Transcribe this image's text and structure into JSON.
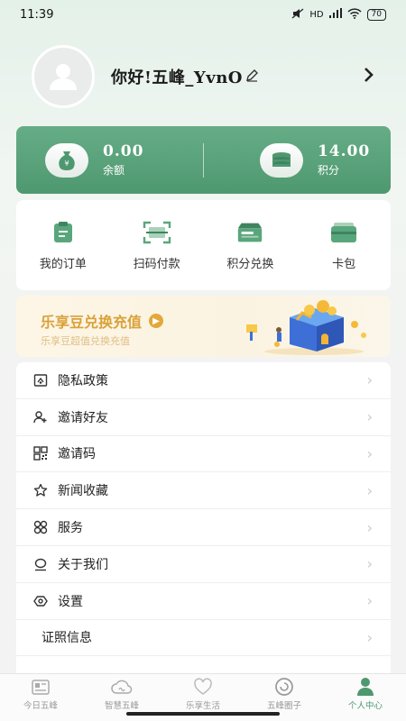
{
  "status_bar": {
    "time": "11:39",
    "battery": "70",
    "network": "HD"
  },
  "profile": {
    "greeting": "你好!五峰_YvnO"
  },
  "wallet": {
    "balance_value": "0.00",
    "balance_label": "余额",
    "points_value": "14.00",
    "points_label": "积分"
  },
  "quick_actions": [
    {
      "label": "我的订单",
      "icon": "order-icon"
    },
    {
      "label": "扫码付款",
      "icon": "scan-icon"
    },
    {
      "label": "积分兑换",
      "icon": "exchange-icon"
    },
    {
      "label": "卡包",
      "icon": "card-icon"
    }
  ],
  "banner": {
    "title": "乐享豆兑换充值",
    "subtitle": "乐享豆超值兑换充值"
  },
  "menu": [
    {
      "label": "隐私政策",
      "icon": "privacy-icon"
    },
    {
      "label": "邀请好友",
      "icon": "invite-friend-icon"
    },
    {
      "label": "邀请码",
      "icon": "qrcode-icon"
    },
    {
      "label": "新闻收藏",
      "icon": "star-icon"
    },
    {
      "label": "服务",
      "icon": "service-icon"
    },
    {
      "label": "关于我们",
      "icon": "about-icon"
    },
    {
      "label": "设置",
      "icon": "settings-icon"
    },
    {
      "label": "证照信息",
      "icon": ""
    }
  ],
  "tabbar": [
    {
      "label": "今日五峰",
      "icon": "news-icon"
    },
    {
      "label": "智慧五峰",
      "icon": "cloud-icon"
    },
    {
      "label": "乐享生活",
      "icon": "heart-icon"
    },
    {
      "label": "五峰圈子",
      "icon": "circle-icon"
    },
    {
      "label": "个人中心",
      "icon": "person-icon"
    }
  ],
  "colors": {
    "primary": "#4e9870",
    "banner_title": "#d9a23a"
  }
}
